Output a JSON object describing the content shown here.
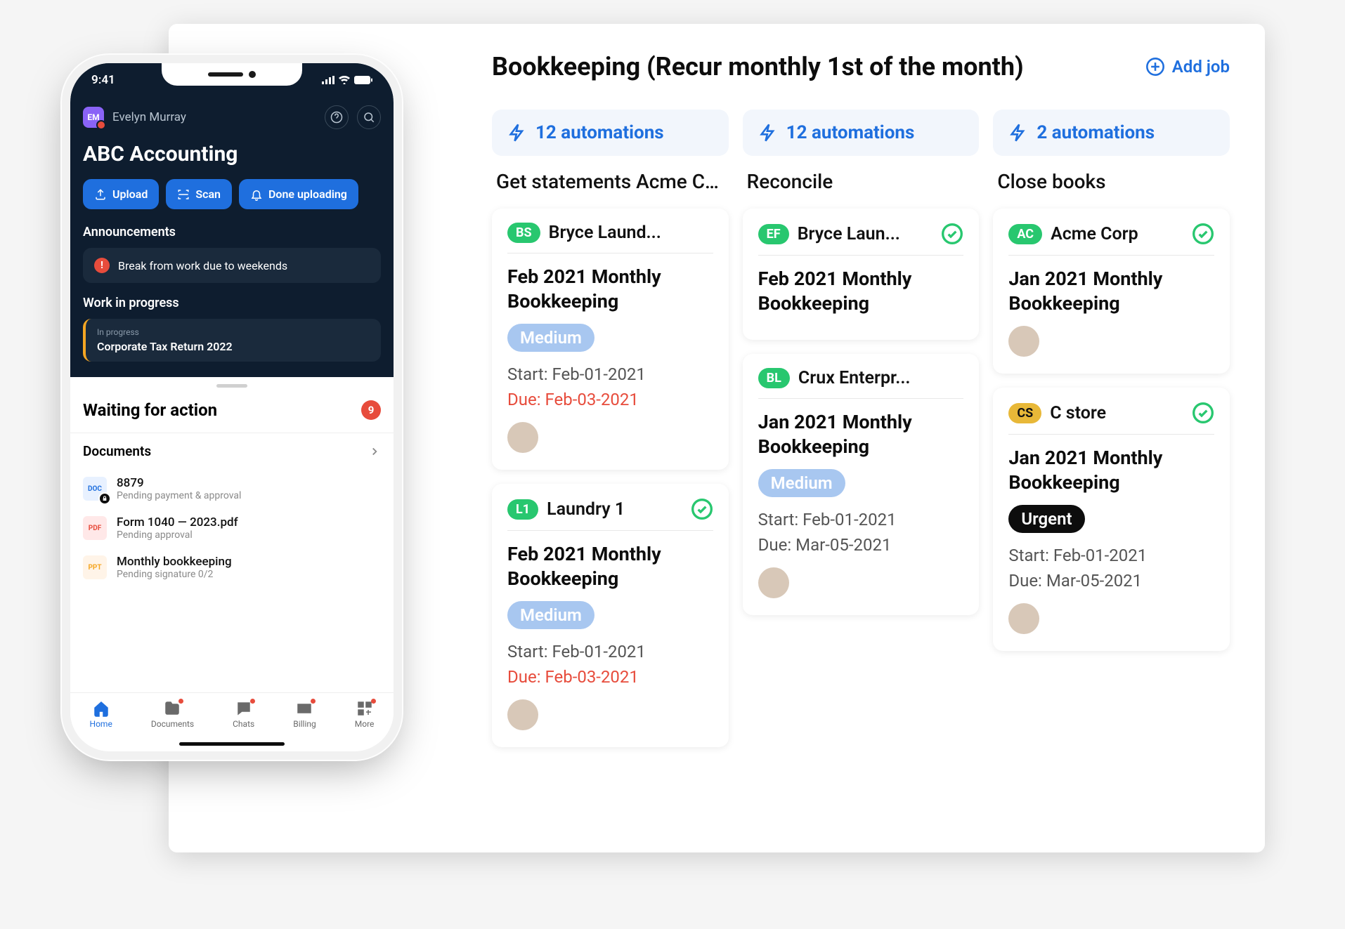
{
  "panel": {
    "title": "Bookkeeping (Recur monthly 1st of the month)",
    "add_job": "Add job"
  },
  "columns": [
    {
      "automations": "12 automations",
      "title": "Get statements Acme Corp",
      "cards": [
        {
          "badge": "BS",
          "badge_color": "green",
          "client": "Bryce Laund...",
          "check": false,
          "title": "Feb 2021 Monthly Bookkeeping",
          "priority": "Medium",
          "priority_class": "medium",
          "start": "Start: Feb-01-2021",
          "due": "Due: Feb-03-2021",
          "due_red": true,
          "avatar": true
        },
        {
          "badge": "L1",
          "badge_color": "green",
          "client": "Laundry 1",
          "check": true,
          "title": "Feb 2021 Monthly Bookkeeping",
          "priority": "Medium",
          "priority_class": "medium",
          "start": "Start: Feb-01-2021",
          "due": "Due: Feb-03-2021",
          "due_red": true,
          "avatar": true
        }
      ]
    },
    {
      "automations": "12 automations",
      "title": "Reconcile",
      "cards": [
        {
          "badge": "EF",
          "badge_color": "green",
          "client": "Bryce Laun...",
          "check": true,
          "title": "Feb 2021 Monthly Bookkeeping",
          "priority": null,
          "start": null,
          "due": null,
          "avatar": false
        },
        {
          "badge": "BL",
          "badge_color": "green",
          "client": "Crux Enterpr...",
          "check": false,
          "title": "Jan 2021 Monthly Bookkeeping",
          "priority": "Medium",
          "priority_class": "medium",
          "start": "Start: Feb-01-2021",
          "due": "Due: Mar-05-2021",
          "due_red": false,
          "avatar": true
        }
      ]
    },
    {
      "automations": "2 automations",
      "title": "Close books",
      "cards": [
        {
          "badge": "AC",
          "badge_color": "green",
          "client": "Acme Corp",
          "check": true,
          "title": "Jan 2021 Monthly Bookkeeping",
          "priority": null,
          "start": null,
          "due": null,
          "avatar": true
        },
        {
          "badge": "CS",
          "badge_color": "yellow",
          "client": "C store",
          "check": true,
          "title": "Jan 2021 Monthly Bookkeeping",
          "priority": "Urgent",
          "priority_class": "urgent",
          "start": "Start: Feb-01-2021",
          "due": "Due: Mar-05-2021",
          "due_red": false,
          "avatar": true
        }
      ]
    }
  ],
  "phone": {
    "time": "9:41",
    "user": {
      "initials": "EM",
      "name": "Evelyn Murray"
    },
    "company": "ABC Accounting",
    "actions": {
      "upload": "Upload",
      "scan": "Scan",
      "done": "Done uploading"
    },
    "announcements": {
      "heading": "Announcements",
      "text": "Break from work due to weekends"
    },
    "wip": {
      "heading": "Work in progress",
      "label": "In progress",
      "title": "Corporate Tax Return 2022"
    },
    "waiting": {
      "title": "Waiting for action",
      "count": "9"
    },
    "documents": {
      "title": "Documents"
    },
    "docs": [
      {
        "icon_type": "doc",
        "icon_text": "DOC",
        "locked": true,
        "name": "8879",
        "status": "Pending payment & approval"
      },
      {
        "icon_type": "pdf",
        "icon_text": "PDF",
        "locked": false,
        "name": "Form 1040 — 2023.pdf",
        "status": "Pending approval"
      },
      {
        "icon_type": "ppt",
        "icon_text": "PPT",
        "locked": false,
        "name": "Monthly bookkeeping",
        "status": "Pending signature 0/2"
      }
    ],
    "tabs": [
      {
        "label": "Home",
        "active": true,
        "dot": false
      },
      {
        "label": "Documents",
        "active": false,
        "dot": true
      },
      {
        "label": "Chats",
        "active": false,
        "dot": true
      },
      {
        "label": "Billing",
        "active": false,
        "dot": true
      },
      {
        "label": "More",
        "active": false,
        "dot": true
      }
    ]
  }
}
